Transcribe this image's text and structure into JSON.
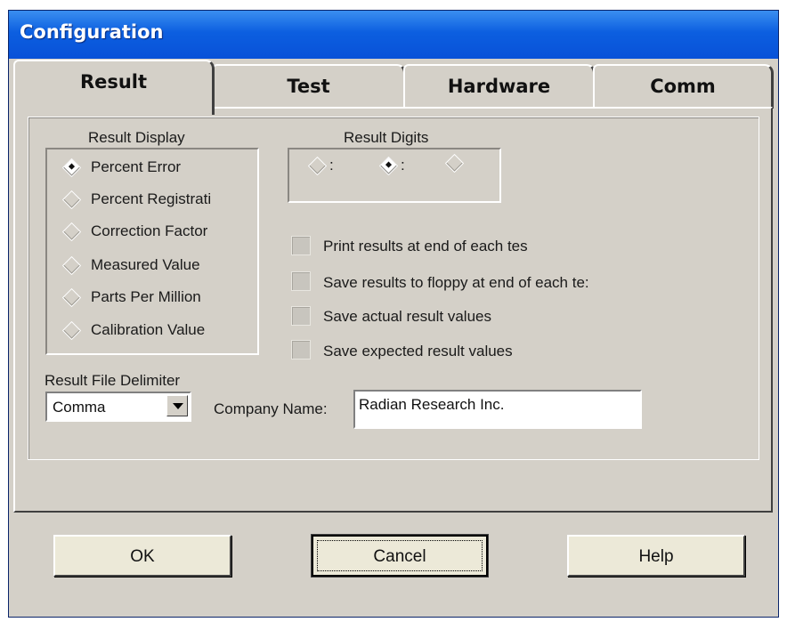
{
  "window": {
    "title": "Configuration"
  },
  "tabs": [
    {
      "label": "Result",
      "active": true
    },
    {
      "label": "Test",
      "active": false
    },
    {
      "label": "Hardware",
      "active": false
    },
    {
      "label": "Comm",
      "active": false
    }
  ],
  "result_display": {
    "label": "Result Display",
    "options": [
      {
        "label": "Percent Error",
        "selected": true
      },
      {
        "label": "Percent Registrati",
        "selected": false
      },
      {
        "label": "Correction Factor",
        "selected": false
      },
      {
        "label": "Measured Value",
        "selected": false
      },
      {
        "label": "Parts Per Million",
        "selected": false
      },
      {
        "label": "Calibration Value",
        "selected": false
      }
    ]
  },
  "result_digits": {
    "label": "Result Digits",
    "options": [
      {
        "label": ":",
        "selected": false
      },
      {
        "label": ":",
        "selected": true
      },
      {
        "label": "",
        "selected": false
      }
    ]
  },
  "checkboxes": [
    {
      "label": "Print results at end of each tes",
      "checked": false
    },
    {
      "label": "Save results to floppy at end of each te:",
      "checked": false
    },
    {
      "label": "Save actual result values",
      "checked": false
    },
    {
      "label": "Save expected result values",
      "checked": false
    }
  ],
  "delimiter": {
    "label": "Result File Delimiter",
    "value": "Comma"
  },
  "company": {
    "label": "Company Name:",
    "value": "Radian Research Inc."
  },
  "buttons": {
    "ok": "OK",
    "cancel": "Cancel",
    "help": "Help"
  }
}
